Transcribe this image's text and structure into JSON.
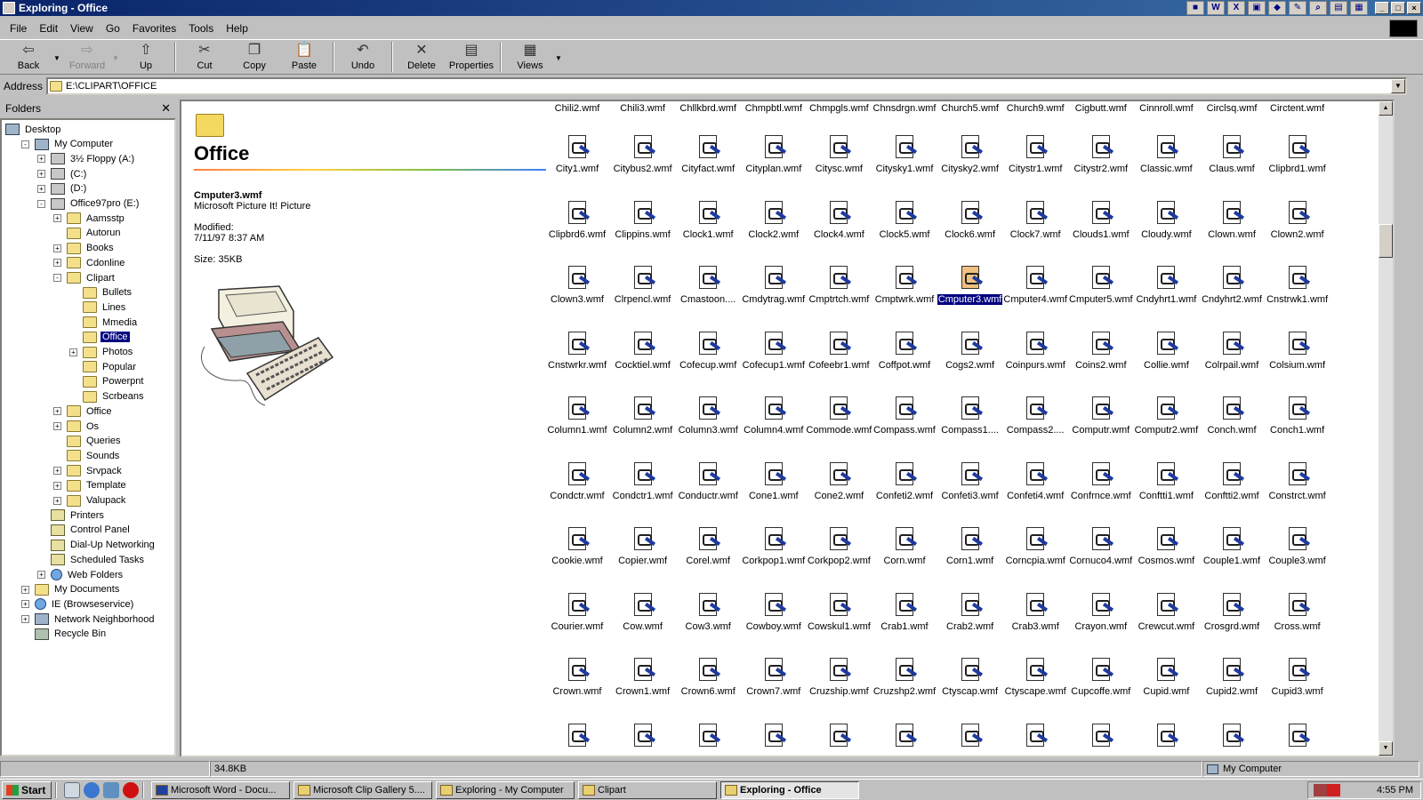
{
  "window": {
    "title": "Exploring - Office"
  },
  "menu": [
    "File",
    "Edit",
    "View",
    "Go",
    "Favorites",
    "Tools",
    "Help"
  ],
  "toolbar": {
    "back": "Back",
    "forward": "Forward",
    "up": "Up",
    "cut": "Cut",
    "copy": "Copy",
    "paste": "Paste",
    "undo": "Undo",
    "delete": "Delete",
    "properties": "Properties",
    "views": "Views"
  },
  "address": {
    "label": "Address",
    "value": "E:\\CLIPART\\OFFICE"
  },
  "folders_pane": {
    "title": "Folders",
    "tree": [
      {
        "label": "Desktop",
        "level": 0,
        "expander": "",
        "icon": "desktop"
      },
      {
        "label": "My Computer",
        "level": 1,
        "expander": "-",
        "icon": "pc"
      },
      {
        "label": "3½ Floppy (A:)",
        "level": 2,
        "expander": "+",
        "icon": "drive"
      },
      {
        "label": "(C:)",
        "level": 2,
        "expander": "+",
        "icon": "drive"
      },
      {
        "label": "(D:)",
        "level": 2,
        "expander": "+",
        "icon": "drive"
      },
      {
        "label": "Office97pro (E:)",
        "level": 2,
        "expander": "-",
        "icon": "drive"
      },
      {
        "label": "Aamsstp",
        "level": 3,
        "expander": "+",
        "icon": "folder"
      },
      {
        "label": "Autorun",
        "level": 3,
        "expander": "",
        "icon": "folder"
      },
      {
        "label": "Books",
        "level": 3,
        "expander": "+",
        "icon": "folder"
      },
      {
        "label": "Cdonline",
        "level": 3,
        "expander": "+",
        "icon": "folder"
      },
      {
        "label": "Clipart",
        "level": 3,
        "expander": "-",
        "icon": "folder"
      },
      {
        "label": "Bullets",
        "level": 4,
        "expander": "",
        "icon": "folder"
      },
      {
        "label": "Lines",
        "level": 4,
        "expander": "",
        "icon": "folder"
      },
      {
        "label": "Mmedia",
        "level": 4,
        "expander": "",
        "icon": "folder"
      },
      {
        "label": "Office",
        "level": 4,
        "expander": "",
        "icon": "folder",
        "selected": true
      },
      {
        "label": "Photos",
        "level": 4,
        "expander": "+",
        "icon": "folder"
      },
      {
        "label": "Popular",
        "level": 4,
        "expander": "",
        "icon": "folder"
      },
      {
        "label": "Powerpnt",
        "level": 4,
        "expander": "",
        "icon": "folder"
      },
      {
        "label": "Scrbeans",
        "level": 4,
        "expander": "",
        "icon": "folder"
      },
      {
        "label": "Office",
        "level": 3,
        "expander": "+",
        "icon": "folder"
      },
      {
        "label": "Os",
        "level": 3,
        "expander": "+",
        "icon": "folder"
      },
      {
        "label": "Queries",
        "level": 3,
        "expander": "",
        "icon": "folder"
      },
      {
        "label": "Sounds",
        "level": 3,
        "expander": "",
        "icon": "folder"
      },
      {
        "label": "Srvpack",
        "level": 3,
        "expander": "+",
        "icon": "folder"
      },
      {
        "label": "Template",
        "level": 3,
        "expander": "+",
        "icon": "folder"
      },
      {
        "label": "Valupack",
        "level": 3,
        "expander": "+",
        "icon": "folder"
      },
      {
        "label": "Printers",
        "level": 2,
        "expander": "",
        "icon": "special"
      },
      {
        "label": "Control Panel",
        "level": 2,
        "expander": "",
        "icon": "special"
      },
      {
        "label": "Dial-Up Networking",
        "level": 2,
        "expander": "",
        "icon": "special"
      },
      {
        "label": "Scheduled Tasks",
        "level": 2,
        "expander": "",
        "icon": "special"
      },
      {
        "label": "Web Folders",
        "level": 2,
        "expander": "+",
        "icon": "globe"
      },
      {
        "label": "My Documents",
        "level": 1,
        "expander": "+",
        "icon": "folder"
      },
      {
        "label": "IE (Browseservice)",
        "level": 1,
        "expander": "+",
        "icon": "globe"
      },
      {
        "label": "Network Neighborhood",
        "level": 1,
        "expander": "+",
        "icon": "pc"
      },
      {
        "label": "Recycle Bin",
        "level": 1,
        "expander": "",
        "icon": "bin"
      }
    ]
  },
  "info": {
    "folder_title": "Office",
    "file_name": "Cmputer3.wmf",
    "file_type": "Microsoft Picture It! Picture",
    "modified_label": "Modified:",
    "modified_value": "7/11/97 8:37 AM",
    "size": "Size: 35KB"
  },
  "files": {
    "partial_top_row": [
      "Chili2.wmf",
      "Chili3.wmf",
      "Chllkbrd.wmf",
      "Chmpbtl.wmf",
      "Chmpgls.wmf",
      "Chnsdrgn.wmf",
      "Church5.wmf",
      "Church9.wmf",
      "Cigbutt.wmf",
      "Cinnroll.wmf",
      "Circlsq.wmf",
      "Circtent.wmf"
    ],
    "rows": [
      [
        "City1.wmf",
        "Citybus2.wmf",
        "Cityfact.wmf",
        "Cityplan.wmf",
        "Citysc.wmf",
        "Citysky1.wmf",
        "Citysky2.wmf",
        "Citystr1.wmf",
        "Citystr2.wmf",
        "Classic.wmf",
        "Claus.wmf",
        "Clipbrd1.wmf"
      ],
      [
        "Clipbrd6.wmf",
        "Clippins.wmf",
        "Clock1.wmf",
        "Clock2.wmf",
        "Clock4.wmf",
        "Clock5.wmf",
        "Clock6.wmf",
        "Clock7.wmf",
        "Clouds1.wmf",
        "Cloudy.wmf",
        "Clown.wmf",
        "Clown2.wmf"
      ],
      [
        "Clown3.wmf",
        "Clrpencl.wmf",
        "Cmastoon....",
        "Cmdytrag.wmf",
        "Cmptrtch.wmf",
        "Cmptwrk.wmf",
        "Cmputer3.wmf",
        "Cmputer4.wmf",
        "Cmputer5.wmf",
        "Cndyhrt1.wmf",
        "Cndyhrt2.wmf",
        "Cnstrwk1.wmf"
      ],
      [
        "Cnstwrkr.wmf",
        "Cocktiel.wmf",
        "Cofecup.wmf",
        "Cofecup1.wmf",
        "Cofeebr1.wmf",
        "Coffpot.wmf",
        "Cogs2.wmf",
        "Coinpurs.wmf",
        "Coins2.wmf",
        "Collie.wmf",
        "Colrpail.wmf",
        "Colsium.wmf"
      ],
      [
        "Column1.wmf",
        "Column2.wmf",
        "Column3.wmf",
        "Column4.wmf",
        "Commode.wmf",
        "Compass.wmf",
        "Compass1....",
        "Compass2....",
        "Computr.wmf",
        "Computr2.wmf",
        "Conch.wmf",
        "Conch1.wmf"
      ],
      [
        "Condctr.wmf",
        "Condctr1.wmf",
        "Conductr.wmf",
        "Cone1.wmf",
        "Cone2.wmf",
        "Confeti2.wmf",
        "Confeti3.wmf",
        "Confeti4.wmf",
        "Confrnce.wmf",
        "Conftti1.wmf",
        "Conftti2.wmf",
        "Constrct.wmf"
      ],
      [
        "Cookie.wmf",
        "Copier.wmf",
        "Corel.wmf",
        "Corkpop1.wmf",
        "Corkpop2.wmf",
        "Corn.wmf",
        "Corn1.wmf",
        "Corncpia.wmf",
        "Cornuco4.wmf",
        "Cosmos.wmf",
        "Couple1.wmf",
        "Couple3.wmf"
      ],
      [
        "Courier.wmf",
        "Cow.wmf",
        "Cow3.wmf",
        "Cowboy.wmf",
        "Cowskul1.wmf",
        "Crab1.wmf",
        "Crab2.wmf",
        "Crab3.wmf",
        "Crayon.wmf",
        "Crewcut.wmf",
        "Crosgrd.wmf",
        "Cross.wmf"
      ],
      [
        "Crown.wmf",
        "Crown1.wmf",
        "Crown6.wmf",
        "Crown7.wmf",
        "Cruzship.wmf",
        "Cruzshp2.wmf",
        "Ctyscap.wmf",
        "Ctyscape.wmf",
        "Cupcoffe.wmf",
        "Cupid.wmf",
        "Cupid2.wmf",
        "Cupid3.wmf"
      ]
    ],
    "selected": "Cmputer3.wmf"
  },
  "status": {
    "size": "34.8KB",
    "location": "My Computer"
  },
  "taskbar": {
    "start": "Start",
    "tasks": [
      "Microsoft Word - Docu...",
      "Microsoft Clip Gallery 5....",
      "Exploring - My Computer",
      "Clipart",
      "Exploring - Office"
    ],
    "active_task": "Exploring - Office",
    "clock": "4:55 PM"
  },
  "colors": {
    "titlebar": "#0a246a",
    "selection": "#000080",
    "face": "#c0c0c0"
  },
  "icons": [
    "folder-icon",
    "wmf-file-icon",
    "back-arrow-icon",
    "cut-icon",
    "copy-icon",
    "paste-icon",
    "undo-icon",
    "delete-icon",
    "properties-icon",
    "views-icon"
  ]
}
